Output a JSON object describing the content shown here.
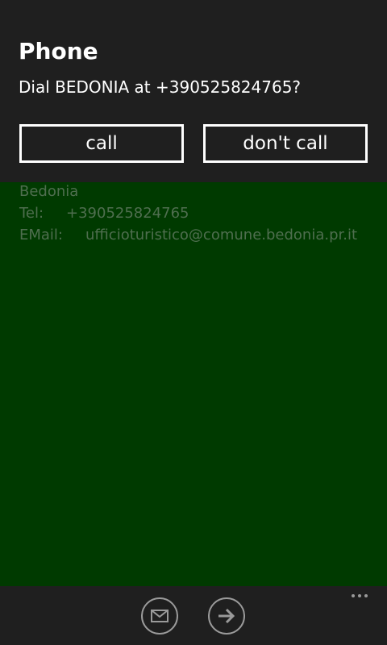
{
  "dialog": {
    "title": "Phone",
    "message": "Dial BEDONIA at +390525824765?",
    "call_label": "call",
    "dont_call_label": "don't call"
  },
  "contact": {
    "name": "Bedonia",
    "tel_label": "Tel:",
    "tel_value": "+390525824765",
    "email_label": "EMail:",
    "email_value": "ufficioturistico@comune.bedonia.pr.it"
  },
  "appbar": {
    "icons": [
      "mail-icon",
      "arrow-right-icon",
      "more-icon"
    ]
  },
  "colors": {
    "background_green": "#003a00",
    "dialog_bg": "#1f1f1f",
    "dim_text": "#4f6e4f"
  }
}
